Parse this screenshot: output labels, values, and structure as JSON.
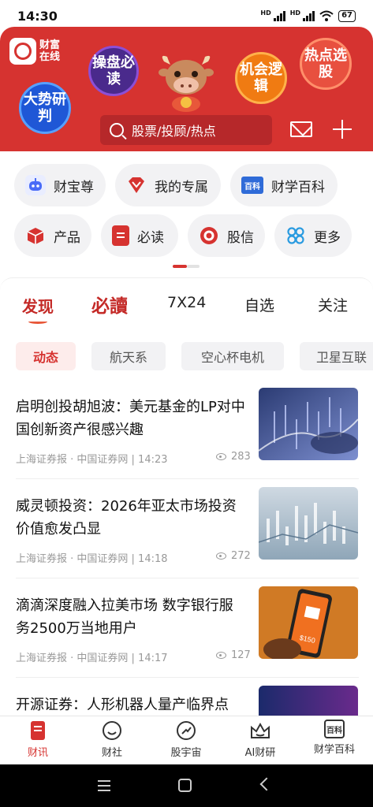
{
  "status_bar": {
    "time": "14:30",
    "network_1": "HD",
    "network_2": "HD",
    "battery": "67"
  },
  "header": {
    "logo_text": "财富在线",
    "bubbles": {
      "caopan": "操盘必读",
      "dashi": "大势研判",
      "jihui": "机会逻辑",
      "redian": "热点选股"
    },
    "search_placeholder": "股票/投顾/热点",
    "icons": [
      "mail-icon",
      "plus-icon",
      "search-icon",
      "mascot-ox"
    ]
  },
  "quick_entries": [
    {
      "label": "财宝尊",
      "icon": "robot-icon",
      "color": "#4a6cf7"
    },
    {
      "label": "我的专属",
      "icon": "diamond-icon",
      "color": "#d63330"
    },
    {
      "label": "财学百科",
      "icon": "encyclopedia-icon",
      "badge": "百科",
      "color": "#2f6bd8"
    },
    {
      "label": "产品",
      "icon": "box-icon",
      "color": "#d63330"
    },
    {
      "label": "必读",
      "icon": "document-icon",
      "color": "#d63330"
    },
    {
      "label": "股信",
      "icon": "message-icon",
      "color": "#d63330"
    },
    {
      "label": "更多",
      "icon": "grid-icon",
      "color": "#2a9be0"
    }
  ],
  "main_tabs": {
    "discover": "发现",
    "bidu": "必讀",
    "seven": "7X24",
    "watchlist": "自选",
    "follow": "关注"
  },
  "chips": [
    "动态",
    "航天系",
    "空心杯电机",
    "卫星互联"
  ],
  "news": [
    {
      "title": "启明创投胡旭波：美元基金的LP对中国创新资产很感兴趣",
      "source": "上海证券报 · 中国证券网 | 14:23",
      "views": "283"
    },
    {
      "title": "威灵顿投资：2026年亚太市场投资价值愈发凸显",
      "source": "上海证券报 · 中国证券网 | 14:18",
      "views": "272"
    },
    {
      "title": "滴滴深度融入拉美市场 数字银行服务2500万当地用户",
      "source": "上海证券报 · 中国证券网 | 14:17",
      "views": "127"
    },
    {
      "title": "开源证券：人形机器人量产临界点"
    }
  ],
  "news_image_labels": {
    "phone_price": "$150"
  },
  "bottom_nav": [
    "财讯",
    "财社",
    "股宇宙",
    "AI财研",
    "财学百科"
  ],
  "bottom_nav_badge": "百科",
  "colors": {
    "brand_red": "#d63330",
    "active_tab": "#c42a27"
  }
}
